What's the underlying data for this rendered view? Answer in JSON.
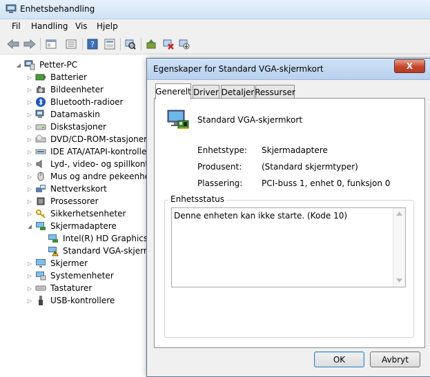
{
  "window": {
    "title": "Enhetsbehandling"
  },
  "menu": [
    "Fil",
    "Handling",
    "Vis",
    "Hjelp"
  ],
  "tree": {
    "root": "Petter-PC",
    "items": [
      "Batterier",
      "Bildeenheter",
      "Bluetooth-radioer",
      "Datamaskin",
      "Diskstasjoner",
      "DVD/CD-ROM-stasjoner",
      "IDE ATA/ATAPI-kontroller",
      "Lyd-, video- og spillkontr",
      "Mus og andre pekeenhete",
      "Nettverkskort",
      "Prosessorer",
      "Sikkerhetsenheter",
      "Skjermadaptere",
      "Intel(R) HD Graphics",
      "Standard VGA-skjermk",
      "Skjermer",
      "Systemenheter",
      "Tastaturer",
      "USB-kontrollere"
    ]
  },
  "dialog": {
    "title": "Egenskaper for Standard VGA-skjermkort",
    "close": "X",
    "tabs": [
      "Generelt",
      "Driver",
      "Detaljer",
      "Ressurser"
    ],
    "device_name": "Standard VGA-skjermkort",
    "props": [
      {
        "label": "Enhetstype:",
        "value": "Skjermadaptere"
      },
      {
        "label": "Produsent:",
        "value": "(Standard skjermtyper)"
      },
      {
        "label": "Plassering:",
        "value": "PCI-buss 1, enhet 0, funksjon 0"
      }
    ],
    "status_legend": "Enhetsstatus",
    "status_text": "Denne enheten kan ikke starte. (Kode 10)",
    "ok": "OK",
    "cancel": "Avbryt"
  }
}
